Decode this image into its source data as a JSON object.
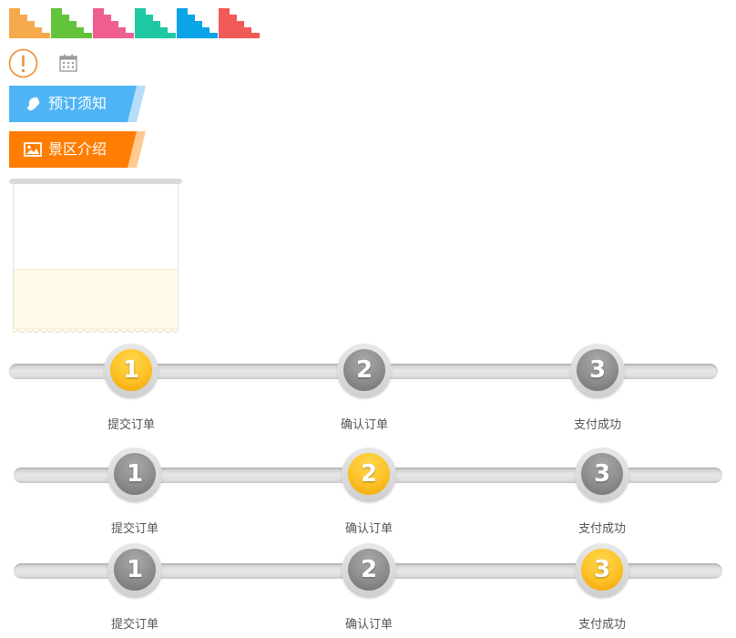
{
  "swatches": [
    {
      "name": "orange",
      "color": "#f7a94d"
    },
    {
      "name": "green",
      "color": "#63c33a"
    },
    {
      "name": "pink",
      "color": "#ee5f8f"
    },
    {
      "name": "teal",
      "color": "#20c8a2"
    },
    {
      "name": "blue",
      "color": "#0aa5e6"
    },
    {
      "name": "red",
      "color": "#f25a57"
    }
  ],
  "icons": {
    "alert": {
      "name": "exclamation-circle-icon",
      "color": "#f08a2c"
    },
    "calendar": {
      "name": "calendar-icon",
      "color": "#9a9a9a"
    }
  },
  "ribbons": {
    "notice": {
      "label": "预订须知",
      "color": "#4fb4f6",
      "tail_color": "#b7ddfb",
      "icon": "bell-icon"
    },
    "intro": {
      "label": "景区介绍",
      "color": "#ff7d00",
      "tail_color": "#ffc98f",
      "icon": "image-icon"
    }
  },
  "steppers": [
    {
      "active": 1,
      "steps": [
        {
          "number": "1",
          "label": "提交订单"
        },
        {
          "number": "2",
          "label": "确认订单"
        },
        {
          "number": "3",
          "label": "支付成功"
        }
      ]
    },
    {
      "active": 2,
      "steps": [
        {
          "number": "1",
          "label": "提交订单"
        },
        {
          "number": "2",
          "label": "确认订单"
        },
        {
          "number": "3",
          "label": "支付成功"
        }
      ]
    },
    {
      "active": 3,
      "steps": [
        {
          "number": "1",
          "label": "提交订单"
        },
        {
          "number": "2",
          "label": "确认订单"
        },
        {
          "number": "3",
          "label": "支付成功"
        }
      ]
    }
  ]
}
